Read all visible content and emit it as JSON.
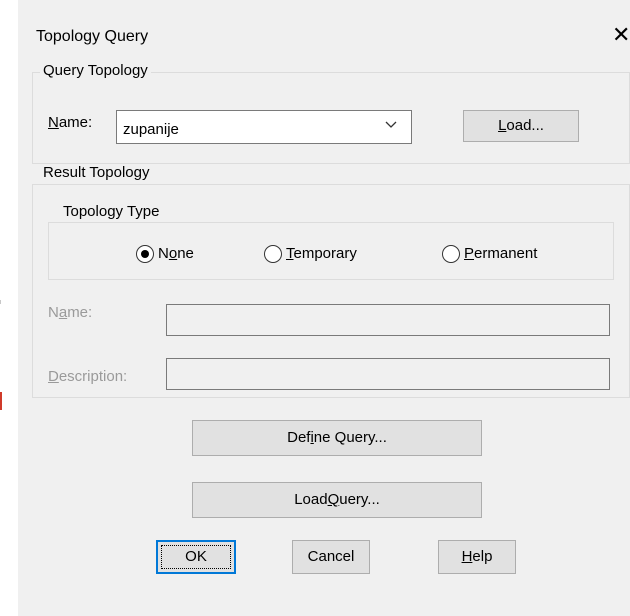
{
  "window": {
    "title": "Topology Query",
    "close_glyph": "✕"
  },
  "query_topology": {
    "group_label": "Query Topology",
    "name_label_prefix": "",
    "name_label_u": "N",
    "name_label_rest": "ame:",
    "combo_value": "zupanije",
    "load_u": "L",
    "load_rest": "oad..."
  },
  "result_topology": {
    "group_label": "Result Topology",
    "type_group_label": "Topology Type",
    "radios": [
      {
        "pre": "N",
        "u": "o",
        "post": "ne",
        "checked": true
      },
      {
        "pre": "",
        "u": "T",
        "post": "emporary",
        "checked": false
      },
      {
        "pre": "",
        "u": "P",
        "post": "ermanent",
        "checked": false
      }
    ],
    "name_field": {
      "pre": "N",
      "u": "a",
      "post": "me:",
      "value": ""
    },
    "description_field": {
      "pre": "",
      "u": "D",
      "post": "escription:",
      "value": ""
    }
  },
  "buttons": {
    "define_query": {
      "pre": "Def",
      "u": "i",
      "post": "ne Query..."
    },
    "load_query": {
      "pre": "Load ",
      "u": "Q",
      "post": "uery..."
    },
    "ok": "OK",
    "cancel": "Cancel",
    "help": {
      "pre": "",
      "u": "H",
      "post": "elp"
    }
  }
}
